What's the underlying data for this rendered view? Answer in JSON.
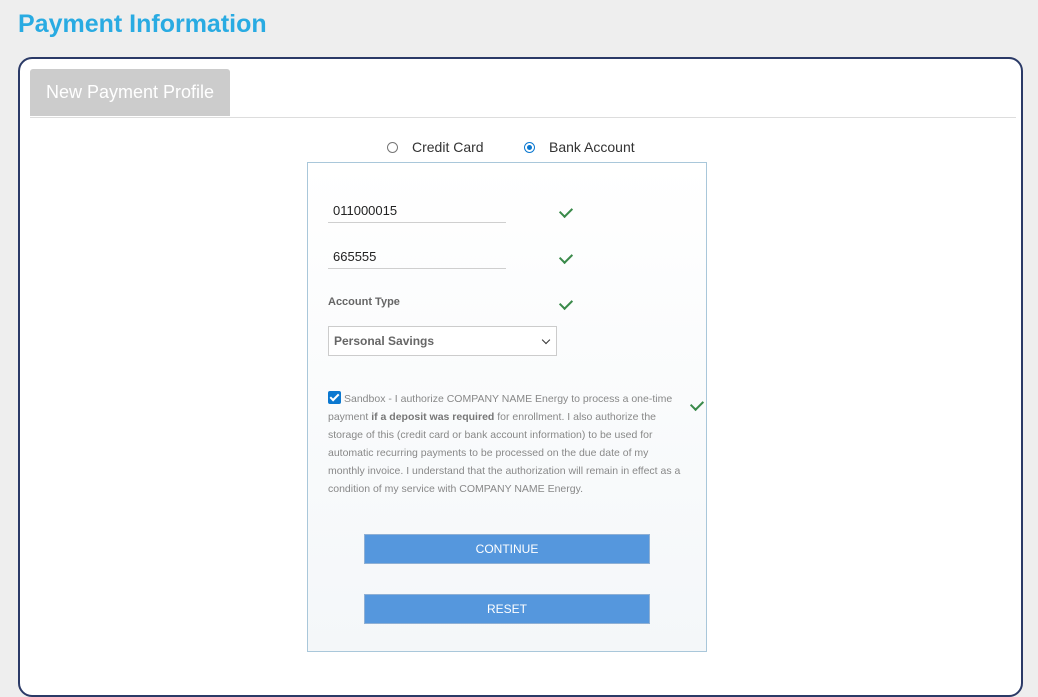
{
  "page": {
    "title": "Payment Information"
  },
  "tabs": [
    {
      "label": "New Payment Profile"
    }
  ],
  "payment_method": {
    "options": [
      {
        "label": "Credit Card",
        "selected": false
      },
      {
        "label": "Bank Account",
        "selected": true
      }
    ]
  },
  "form": {
    "routing_number": "011000015",
    "account_number": "665555",
    "account_type_label": "Account Type",
    "account_type_value": "Personal Savings",
    "consent": {
      "checked": true,
      "text_part1": "Sandbox - I authorize COMPANY NAME Energy to process a one-time payment ",
      "text_bold": "if a deposit was required",
      "text_part2": " for enrollment. I also authorize the storage of this (credit card or bank account information) to be used for automatic recurring payments to be processed on the due date of my monthly invoice. I understand that the authorization will remain in effect as a condition of my service with COMPANY NAME Energy."
    },
    "continue_label": "CONTINUE",
    "reset_label": "RESET"
  },
  "colors": {
    "title": "#29abe2",
    "button": "#5597dd",
    "card_border": "#2b3a67",
    "valid_check": "#3a8a4a",
    "radio_selected": "#0b78d0"
  },
  "icons": [
    "valid-check-icon",
    "chevron-down-icon",
    "checkbox-checked-icon"
  ]
}
